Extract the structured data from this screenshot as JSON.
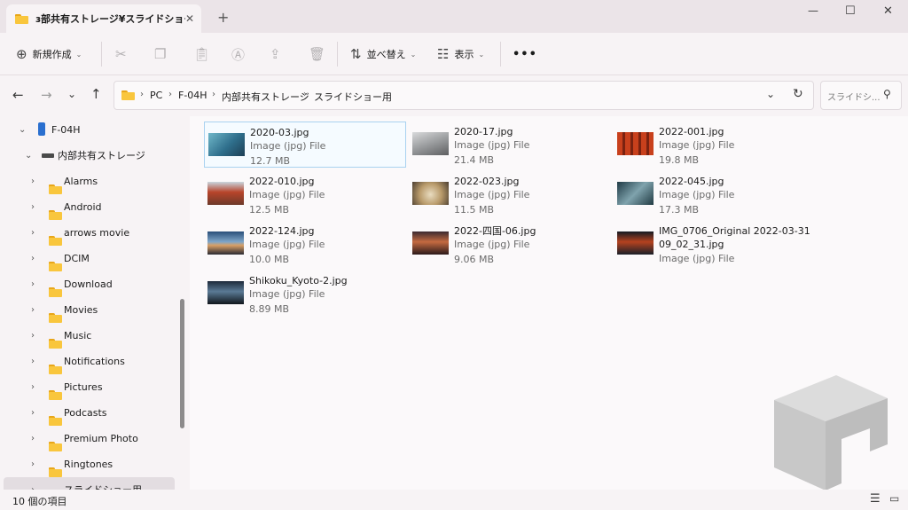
{
  "tab": {
    "title": "ɜ部共有ストレージ¥スライドショー用",
    "close": "✕",
    "new": "+"
  },
  "window_controls": {
    "minimize": "—",
    "maximize": "☐",
    "close": "✕"
  },
  "toolbar": {
    "new_label": "新規作成",
    "sort_label": "並べ替え",
    "view_label": "表示",
    "more_label": "•••"
  },
  "address": {
    "crumbs": [
      "PC",
      "F-04H",
      "内部共有ストレージ",
      "スライドショー用"
    ],
    "search_placeholder": "スライドシ..."
  },
  "sidebar": {
    "items": [
      {
        "label": "F-04H"
      },
      {
        "label": "内部共有ストレージ"
      },
      {
        "label": "Alarms"
      },
      {
        "label": "Android"
      },
      {
        "label": "arrows movie"
      },
      {
        "label": "DCIM"
      },
      {
        "label": "Download"
      },
      {
        "label": "Movies"
      },
      {
        "label": "Music"
      },
      {
        "label": "Notifications"
      },
      {
        "label": "Pictures"
      },
      {
        "label": "Podcasts"
      },
      {
        "label": "Premium Photo"
      },
      {
        "label": "Ringtones"
      },
      {
        "label": "スライドショー用"
      }
    ]
  },
  "files": [
    {
      "name": "2020-03.jpg",
      "type": "Image (jpg) File",
      "size": "12.7 MB"
    },
    {
      "name": "2020-17.jpg",
      "type": "Image (jpg) File",
      "size": "21.4 MB"
    },
    {
      "name": "2022-001.jpg",
      "type": "Image (jpg) File",
      "size": "19.8 MB"
    },
    {
      "name": "2022-010.jpg",
      "type": "Image (jpg) File",
      "size": "12.5 MB"
    },
    {
      "name": "2022-023.jpg",
      "type": "Image (jpg) File",
      "size": "11.5 MB"
    },
    {
      "name": "2022-045.jpg",
      "type": "Image (jpg) File",
      "size": "17.3 MB"
    },
    {
      "name": "2022-124.jpg",
      "type": "Image (jpg) File",
      "size": "10.0 MB"
    },
    {
      "name": "2022-四国-06.jpg",
      "type": "Image (jpg) File",
      "size": "9.06 MB"
    },
    {
      "name": "IMG_0706_Original 2022-03-31",
      "name2": "09_02_31.jpg",
      "type": "Image (jpg) File",
      "size": ""
    },
    {
      "name": "Shikoku_Kyoto-2.jpg",
      "type": "Image (jpg) File",
      "size": "8.89 MB"
    }
  ],
  "status": {
    "count": "10 個の項目"
  }
}
